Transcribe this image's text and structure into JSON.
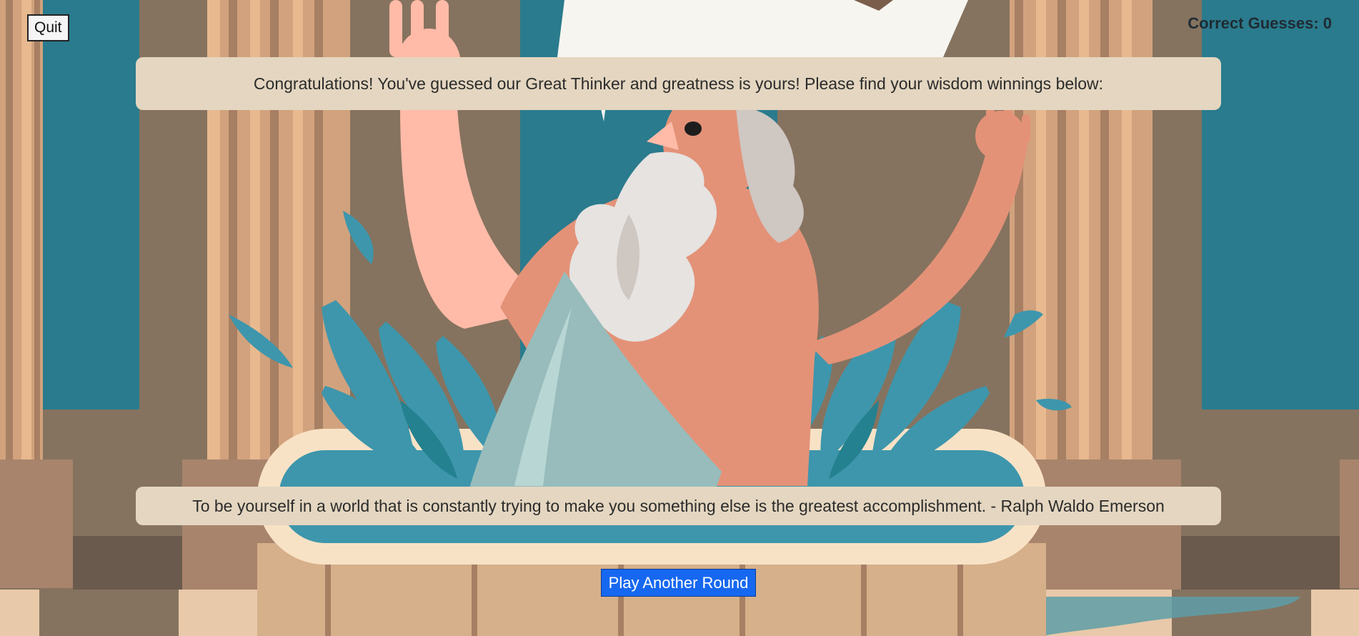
{
  "header": {
    "quit_label": "Quit",
    "score_text": "Correct Guesses: 0"
  },
  "result": {
    "message": "Congratulations! You've guessed our Great Thinker and greatness is yours! Please find your wisdom winnings below:",
    "quote": "To be yourself in a world that is constantly trying to make you something else is the greatest accomplishment. - Ralph Waldo Emerson"
  },
  "actions": {
    "play_again_label": "Play Another Round"
  },
  "colors": {
    "banner_bg": "#e4d6c0",
    "play_button_bg": "#1668f0",
    "pillar_teal": "#2a7b8d",
    "wall_brown": "#85735f",
    "water_blue": "#3e96ac"
  }
}
